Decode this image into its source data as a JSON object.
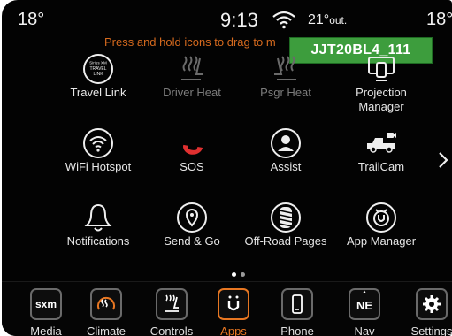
{
  "status": {
    "temp_left": "18°",
    "time": "9:13",
    "outside_temp": "21°",
    "outside_suffix": "out.",
    "temp_right": "18°"
  },
  "hint": "Press and hold icons to drag to m",
  "watermark": "JJT20BL4_111",
  "apps": [
    {
      "label": "Travel Link",
      "icon": "travel-link-icon",
      "enabled": true,
      "icon_text": "Sirius XM TRAVEL LINK"
    },
    {
      "label": "Driver Heat",
      "icon": "driver-heat-seat-icon",
      "enabled": false
    },
    {
      "label": "Psgr Heat",
      "icon": "passenger-heat-seat-icon",
      "enabled": false
    },
    {
      "label": "Projection Manager",
      "icon": "projection-manager-icon",
      "enabled": true
    },
    {
      "label": "WiFi Hotspot",
      "icon": "wifi-icon",
      "enabled": true
    },
    {
      "label": "SOS",
      "icon": "phone-icon",
      "enabled": true
    },
    {
      "label": "Assist",
      "icon": "assist-person-icon",
      "enabled": true
    },
    {
      "label": "TrailCam",
      "icon": "truck-camera-icon",
      "enabled": true
    },
    {
      "label": "Notifications",
      "icon": "bell-icon",
      "enabled": true
    },
    {
      "label": "Send & Go",
      "icon": "location-pin-icon",
      "enabled": true
    },
    {
      "label": "Off-Road Pages",
      "icon": "tire-icon",
      "enabled": true
    },
    {
      "label": "App Manager",
      "icon": "app-manager-icon",
      "enabled": true
    }
  ],
  "page_indicator": {
    "pages": 2,
    "current": 1
  },
  "nav": [
    {
      "label": "Media",
      "icon": "sxm-icon",
      "icon_text": "sxm",
      "active": false
    },
    {
      "label": "Climate",
      "icon": "climate-icon",
      "active": false
    },
    {
      "label": "Controls",
      "icon": "controls-icon",
      "active": false
    },
    {
      "label": "Apps",
      "icon": "apps-icon",
      "active": true
    },
    {
      "label": "Phone",
      "icon": "phone-device-icon",
      "active": false
    },
    {
      "label": "Nav",
      "icon": "compass-icon",
      "icon_text": "NE",
      "active": false
    },
    {
      "label": "Settings",
      "icon": "gear-icon",
      "active": false
    }
  ],
  "colors": {
    "accent": "#e87722",
    "sos_red": "#e03030",
    "watermark_green": "#3d9d3d"
  }
}
